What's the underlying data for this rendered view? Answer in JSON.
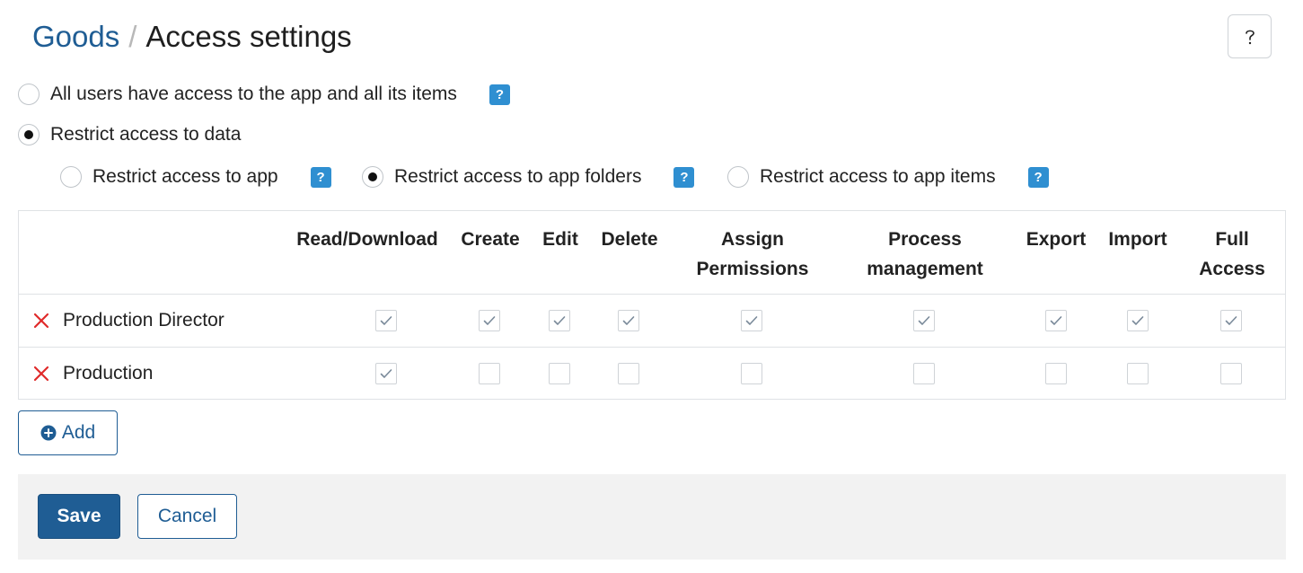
{
  "breadcrumb": {
    "parent": "Goods",
    "separator": "/",
    "title": "Access settings"
  },
  "help_button": {
    "icon": "question-mark-icon"
  },
  "access_mode": {
    "options": [
      {
        "label": "All users have access to the app and all its items",
        "selected": false
      },
      {
        "label": "Restrict access to data",
        "selected": true
      }
    ],
    "help_badge": "?"
  },
  "restrict_options": {
    "items": [
      {
        "label": "Restrict access to app",
        "selected": false,
        "help": "?"
      },
      {
        "label": "Restrict access to app folders",
        "selected": true,
        "help": "?"
      },
      {
        "label": "Restrict access to app items",
        "selected": false,
        "help": "?"
      }
    ]
  },
  "table": {
    "columns": [
      "Read/Download",
      "Create",
      "Edit",
      "Delete",
      "Assign\nPermissions",
      "Process\nmanagement",
      "Export",
      "Import",
      "Full\nAccess"
    ],
    "rows": [
      {
        "name": "Production Director",
        "checks": [
          true,
          true,
          true,
          true,
          true,
          true,
          true,
          true,
          true
        ]
      },
      {
        "name": "Production",
        "checks": [
          true,
          false,
          false,
          false,
          false,
          false,
          false,
          false,
          false
        ]
      }
    ]
  },
  "add_button": {
    "label": "Add"
  },
  "footer": {
    "save_label": "Save",
    "cancel_label": "Cancel"
  },
  "colors": {
    "accent": "#1f5d94",
    "help_badge": "#2f8fd1",
    "remove": "#e02a2a",
    "footer_bg": "#f2f2f2"
  }
}
